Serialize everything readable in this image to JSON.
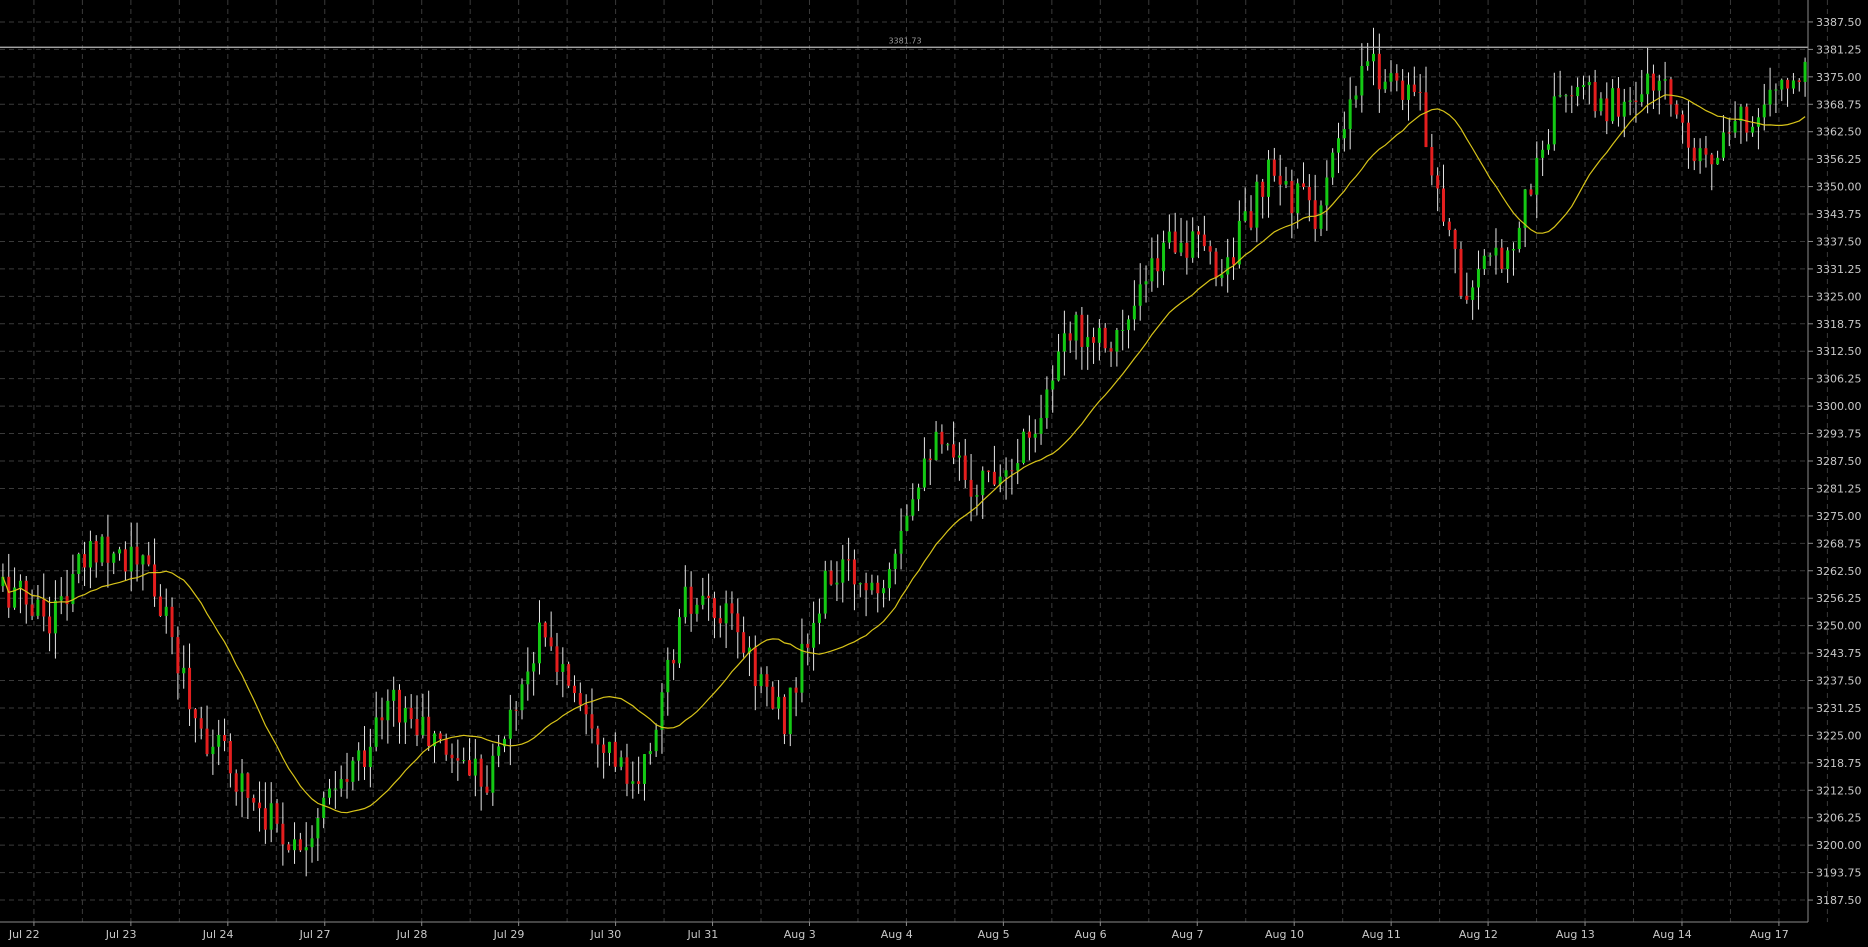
{
  "chart_data": {
    "type": "candlestick",
    "title": "",
    "xlabel": "",
    "ylabel": "",
    "ylim": [
      3182.5,
      3392.5
    ],
    "y_ticks": [
      "3387.50",
      "3381.25",
      "3375.00",
      "3368.75",
      "3362.50",
      "3356.25",
      "3350.00",
      "3343.75",
      "3337.50",
      "3331.25",
      "3325.00",
      "3318.75",
      "3312.50",
      "3306.25",
      "3300.00",
      "3293.75",
      "3287.50",
      "3281.25",
      "3275.00",
      "3268.75",
      "3262.50",
      "3256.25",
      "3250.00",
      "3243.75",
      "3237.50",
      "3231.25",
      "3225.00",
      "3218.75",
      "3212.50",
      "3206.25",
      "3200.00",
      "3193.75",
      "3187.50"
    ],
    "x_ticks": [
      "Jul 22",
      "Jul 23",
      "Jul 24",
      "Jul 27",
      "Jul 28",
      "Jul 29",
      "Jul 30",
      "Jul 31",
      "Aug 3",
      "Aug 4",
      "Aug 5",
      "Aug 6",
      "Aug 7",
      "Aug 10",
      "Aug 11",
      "Aug 12",
      "Aug 13",
      "Aug 14",
      "Aug 17"
    ],
    "horizontal_line": {
      "value": 3381.73,
      "label": "3381.73"
    },
    "grid": true,
    "colors": {
      "up": "#14c814",
      "down": "#e41e1e",
      "wick": "#e6e6e6",
      "ma": "#d8c419",
      "background": "#000000"
    },
    "series": [
      {
        "name": "",
        "type": "ohlc",
        "day_close_path": [
          3259,
          3252,
          3270,
          3262,
          3228,
          3213,
          3200,
          3214,
          3233,
          3222,
          3216,
          3248,
          3232,
          3210,
          3255,
          3250,
          3228,
          3262,
          3260,
          3292,
          3282,
          3292,
          3318,
          3316,
          3340,
          3331,
          3352,
          3344,
          3378,
          3372,
          3325,
          3338,
          3372,
          3368,
          3374,
          3355,
          3368,
          3376
        ]
      },
      {
        "name": "",
        "type": "moving_average",
        "source": "close",
        "period": 20
      }
    ]
  }
}
